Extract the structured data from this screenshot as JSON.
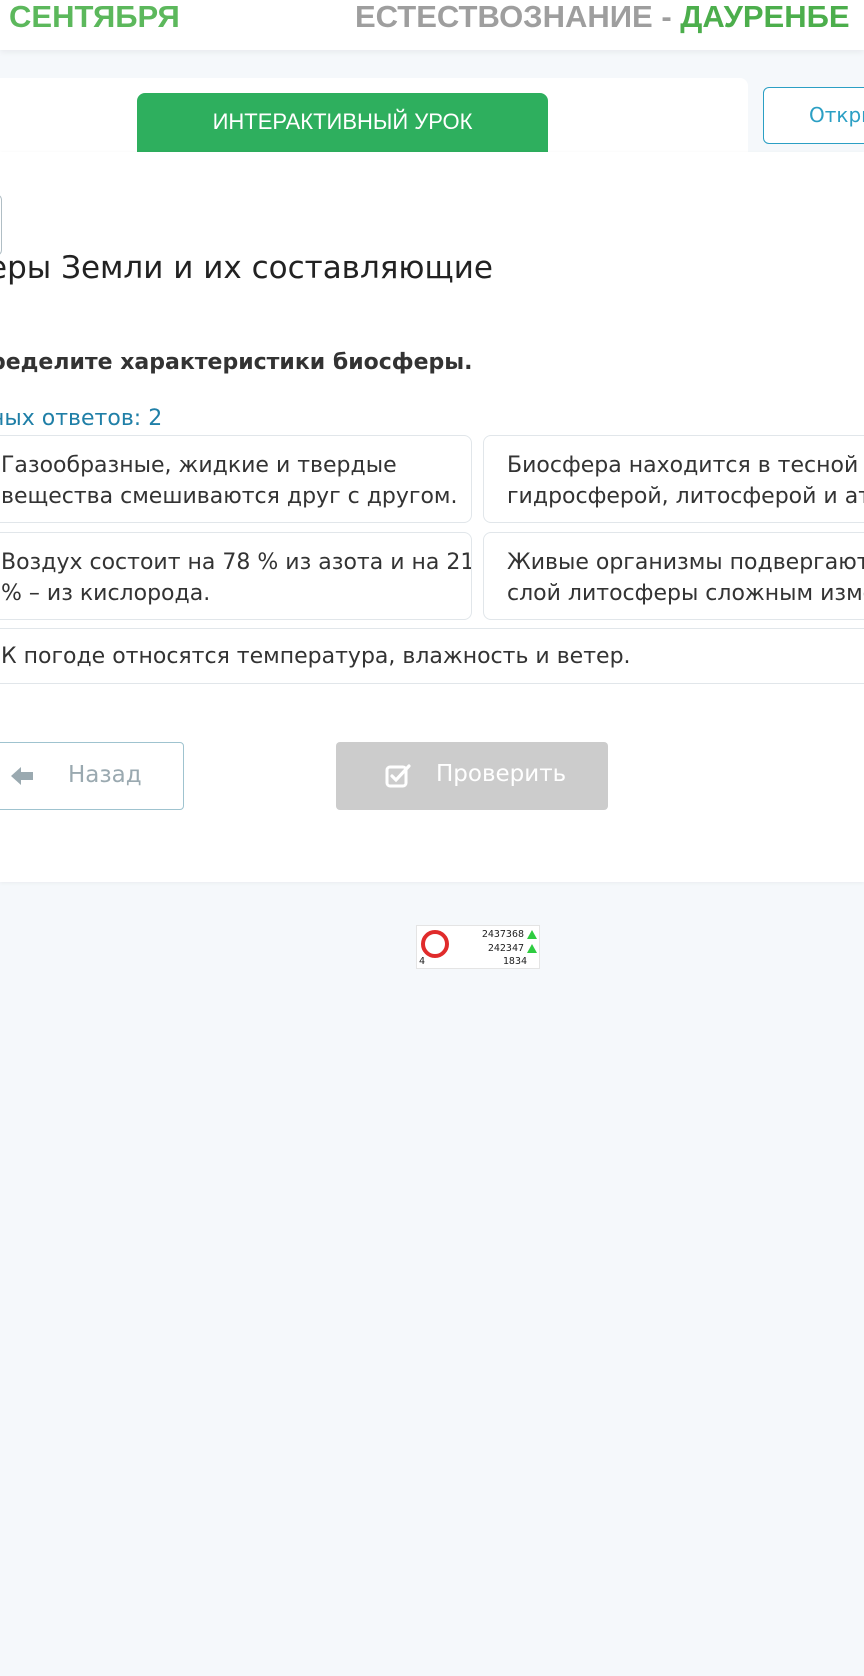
{
  "header": {
    "date_fragment": "СЕНТЯБРЯ",
    "subject": "ЕСТЕСТВОЗНАНИЕ - ",
    "teacher": "ДАУРЕНБЕ"
  },
  "tabs": {
    "active_label": "ИНТЕРАКТИВНЫЙ УРОК",
    "open_label": "Откры"
  },
  "lesson": {
    "title": "еры Земли и их составляющие",
    "task": "ределите характеристики биосферы.",
    "answers_counter": "ных ответов: 2"
  },
  "options": [
    {
      "line1": "Газообразные, жидкие и твердые",
      "line2": "вещества смешиваются друг с другом."
    },
    {
      "line1": "Биосфера находится в тесной св",
      "line2": "гидросферой, литосферой и атм"
    },
    {
      "line1": "Воздух состоит на 78 % из азота и на 21",
      "line2": "% – из кислорода."
    },
    {
      "line1": "Живые организмы подвергают в",
      "line2": "слой литосферы сложным измен"
    },
    {
      "line1": "К погоде относятся температура, влажность и ветер."
    }
  ],
  "buttons": {
    "back_label": "Назад",
    "check_label": "Проверить"
  },
  "counter_widget": {
    "value1": "2437368",
    "value2": "242347",
    "value3": "1834",
    "value4": "4"
  },
  "colors": {
    "accent_green": "#2eaf5e",
    "link_blue": "#1f7fa7",
    "disabled_gray": "#cccccc"
  }
}
